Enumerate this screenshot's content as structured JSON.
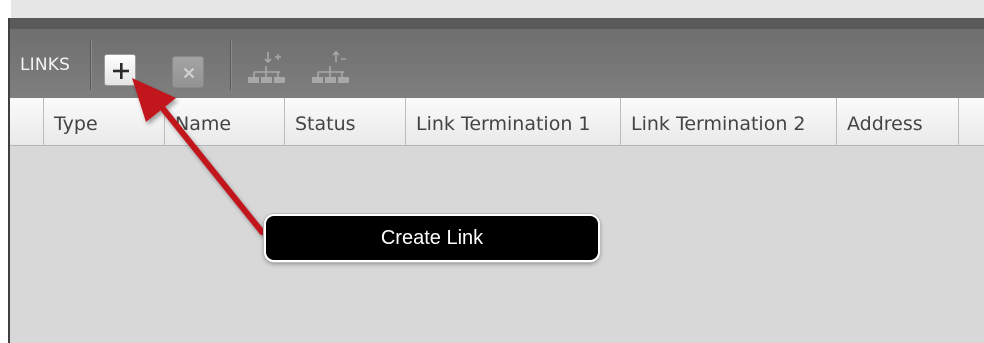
{
  "toolbar": {
    "section_label": "LINKS",
    "buttons": {
      "add": "add-link",
      "delete": "delete-link",
      "add_child": "add-child-node",
      "remove_child": "remove-child-node"
    }
  },
  "table": {
    "columns": [
      "",
      "Type",
      "Name",
      "Status",
      "Link Termination 1",
      "Link Termination 2",
      "Address",
      ""
    ]
  },
  "callout": {
    "text": "Create Link"
  },
  "colors": {
    "toolbar_bg": "#767676",
    "panel_bg": "#d8d8d8",
    "header_bg": "#f2f2f2",
    "arrow": "#c0141c",
    "callout_bg": "#000000"
  }
}
